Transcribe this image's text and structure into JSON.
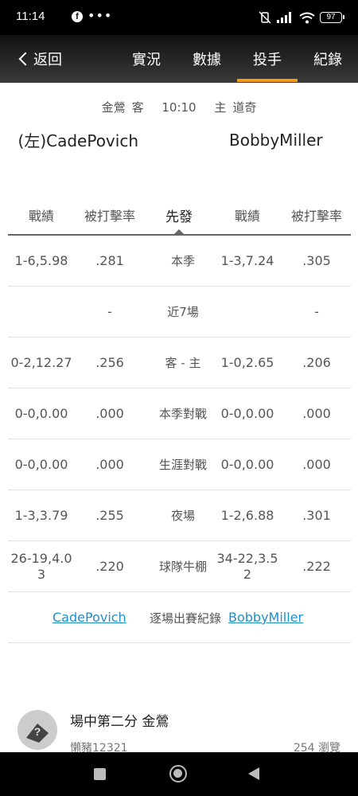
{
  "status_bar": {
    "time": "11:14",
    "battery": "97"
  },
  "header": {
    "back_label": "返回",
    "tabs": [
      {
        "label": "實況"
      },
      {
        "label": "數據"
      },
      {
        "label": "投手",
        "active": true
      },
      {
        "label": "紀錄"
      }
    ],
    "accent_color": "#f39c12"
  },
  "game": {
    "away_team": "金鶯",
    "away_tag": "客",
    "time": "10:10",
    "home_tag": "主",
    "home_team": "道奇"
  },
  "pitchers": {
    "left": "(左)CadePovich",
    "right": "BobbyMiller"
  },
  "table": {
    "headers": [
      "戰績",
      "被打擊率",
      "先發",
      "戰績",
      "被打擊率"
    ],
    "rows": [
      {
        "away_record": "1-6,5.98",
        "away_avg": ".281",
        "label": "本季",
        "home_record": "1-3,7.24",
        "home_avg": ".305"
      },
      {
        "away_record": "",
        "away_avg": "-",
        "label": "近7場",
        "home_record": "",
        "home_avg": "-"
      },
      {
        "away_record": "0-2,12.27",
        "away_avg": ".256",
        "label": "客 - 主",
        "home_record": "1-0,2.65",
        "home_avg": ".206"
      },
      {
        "away_record": "0-0,0.00",
        "away_avg": ".000",
        "label": "本季對戰",
        "home_record": "0-0,0.00",
        "home_avg": ".000"
      },
      {
        "away_record": "0-0,0.00",
        "away_avg": ".000",
        "label": "生涯對戰",
        "home_record": "0-0,0.00",
        "home_avg": ".000"
      },
      {
        "away_record": "1-3,3.79",
        "away_avg": ".255",
        "label": "夜場",
        "home_record": "1-2,6.88",
        "home_avg": ".301"
      },
      {
        "away_record": "26-19,4.03",
        "away_avg": ".220",
        "label": "球隊牛棚",
        "home_record": "34-22,3.52",
        "home_avg": ".222"
      }
    ]
  },
  "game_logs": {
    "left_link": "CadePovich",
    "middle": "逐場出賽紀錄",
    "right_link": "BobbyMiller",
    "link_color": "#1e90d0"
  },
  "post": {
    "title": "場中第二分 金鶯",
    "author": "懶豬12321",
    "views": "254 瀏覽"
  }
}
